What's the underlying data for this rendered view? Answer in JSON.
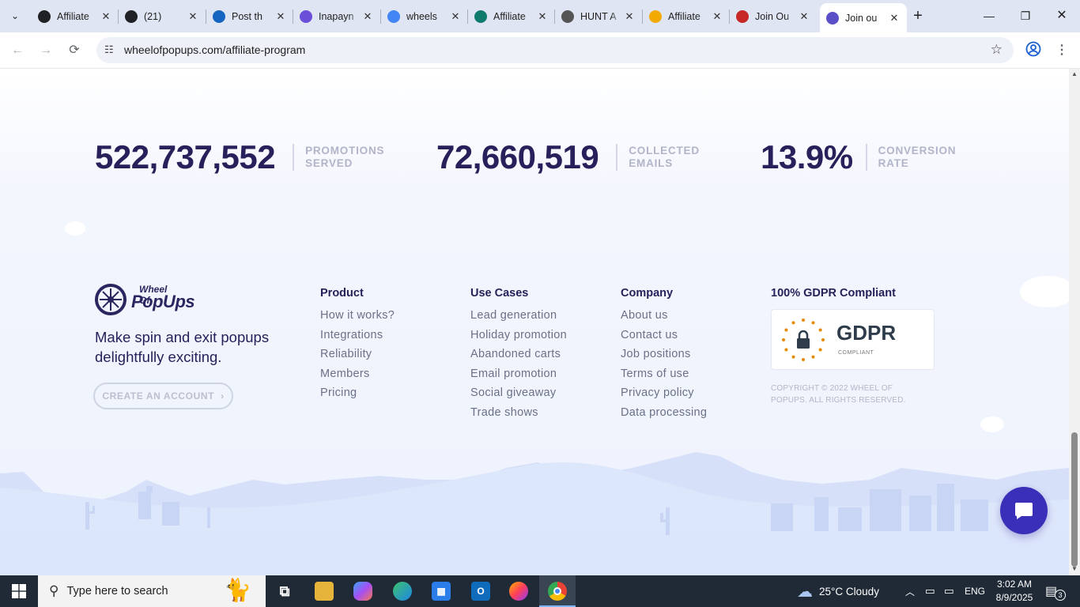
{
  "browser": {
    "tabs": [
      {
        "title": "Affiliate",
        "favicon": "openai-icon",
        "color": "#202124"
      },
      {
        "title": "(21)",
        "favicon": "b-icon",
        "color": "#202124"
      },
      {
        "title": "Post th",
        "favicon": "xf-icon",
        "color": "#1565c0"
      },
      {
        "title": "Inapayn",
        "favicon": "e-icon",
        "color": "#6b4fd8"
      },
      {
        "title": "wheels",
        "favicon": "google-icon",
        "color": "#4285f4"
      },
      {
        "title": "Affiliate",
        "favicon": "shield-icon",
        "color": "#0f7a6d"
      },
      {
        "title": "HUNT A",
        "favicon": "slash-icon",
        "color": "#555555"
      },
      {
        "title": "Affiliate",
        "favicon": "coin-icon",
        "color": "#f2a900"
      },
      {
        "title": "Join Ou",
        "favicon": "target-icon",
        "color": "#c62828"
      },
      {
        "title": "Join ou",
        "favicon": "wheel-icon",
        "color": "#5b4fc7"
      }
    ],
    "url": "wheelofpopups.com/affiliate-program"
  },
  "stats": [
    {
      "value": "522,737,552",
      "label_1": "PROMOTIONS",
      "label_2": "SERVED"
    },
    {
      "value": "72,660,519",
      "label_1": "COLLECTED",
      "label_2": "EMAILS"
    },
    {
      "value": "13.9%",
      "label_1": "CONVERSION",
      "label_2": "RATE"
    }
  ],
  "footer": {
    "logo_line_1": "Wheel Of",
    "logo_line_2": "PopUps",
    "tagline": "Make spin and exit popups delightfully exciting.",
    "cta": "CREATE AN ACCOUNT",
    "columns": [
      {
        "heading": "Product",
        "links": [
          "How it works?",
          "Integrations",
          "Reliability",
          "Members",
          "Pricing"
        ]
      },
      {
        "heading": "Use Cases",
        "links": [
          "Lead generation",
          "Holiday promotion",
          "Abandoned carts",
          "Email promotion",
          "Social giveaway",
          "Trade shows"
        ]
      },
      {
        "heading": "Company",
        "links": [
          "About us",
          "Contact us",
          "Job positions",
          "Terms of use",
          "Privacy policy",
          "Data processing"
        ]
      }
    ],
    "gdpr_heading": "100% GDPR Compliant",
    "gdpr_badge_title": "GDPR",
    "gdpr_badge_sub": "COMPLIANT",
    "copyright": "COPYRIGHT © 2022 WHEEL OF POPUPS. ALL RIGHTS RESERVED."
  },
  "taskbar": {
    "search_placeholder": "Type here to search",
    "weather": "25°C  Cloudy",
    "language": "ENG",
    "time": "3:02 AM",
    "date": "8/9/2025",
    "notification_count": "3"
  },
  "colors": {
    "accent": "#26215a",
    "chat": "#3a2fb8",
    "link": "#6c7087"
  }
}
